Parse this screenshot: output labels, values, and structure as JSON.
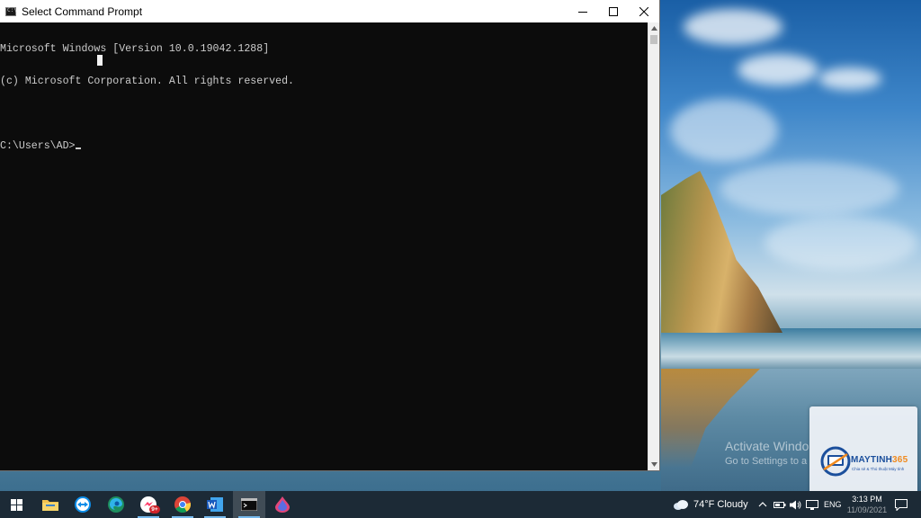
{
  "window": {
    "title": "Select Command Prompt",
    "app_icon_text": "C:\\"
  },
  "console": {
    "lines": [
      "Microsoft Windows [Version 10.0.19042.1288]",
      "(c) Microsoft Corporation. All rights reserved.",
      "",
      "C:\\Users\\AD>"
    ]
  },
  "desktop": {
    "activate_title": "Activate Windo",
    "activate_subtitle": "Go to Settings to a",
    "logo_text_main": "MAYTINH",
    "logo_text_accent": "365",
    "logo_tagline": "Chia sẻ & Thủ thuật Máy tính"
  },
  "taskbar": {
    "items": [
      {
        "name": "start",
        "icon": "windows-logo-icon"
      },
      {
        "name": "file-explorer",
        "icon": "folder-icon"
      },
      {
        "name": "teamviewer",
        "icon": "teamviewer-icon"
      },
      {
        "name": "edge",
        "icon": "edge-icon"
      },
      {
        "name": "messenger",
        "icon": "messenger-icon",
        "badge": "9+"
      },
      {
        "name": "chrome",
        "icon": "chrome-icon"
      },
      {
        "name": "word",
        "icon": "word-icon"
      },
      {
        "name": "command-prompt",
        "icon": "console-icon"
      },
      {
        "name": "app-drop",
        "icon": "drop-icon"
      }
    ],
    "weather": "74°F  Cloudy",
    "language": "ENG",
    "time": "3:13 PM",
    "date": "11/09/2021"
  },
  "colors": {
    "console_bg": "#0c0c0c",
    "console_text": "#cccccc",
    "taskbar_bg": "#1c2a36",
    "accent": "#76b9ed"
  }
}
